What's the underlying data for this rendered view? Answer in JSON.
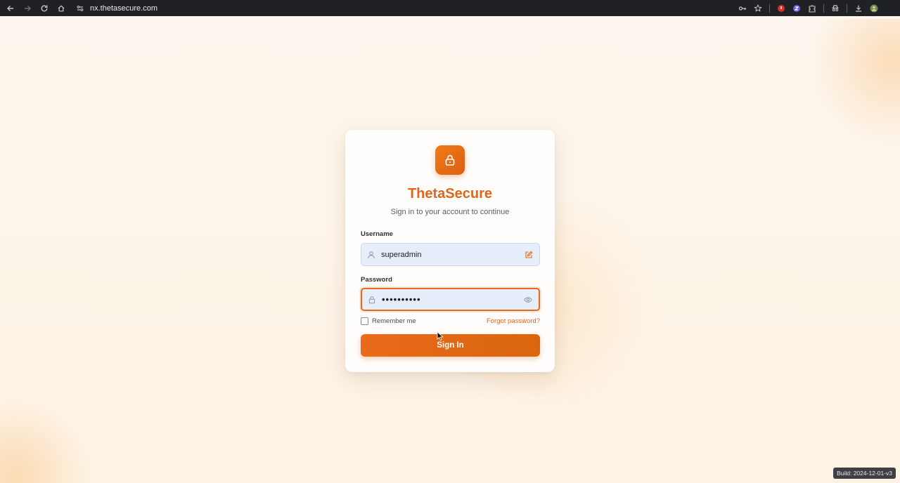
{
  "browser": {
    "url": "nx.thetasecure.com",
    "nav_icons": [
      "back-icon",
      "forward-icon",
      "reload-icon",
      "home-icon"
    ],
    "right_icons": [
      "key-icon",
      "star-icon",
      "extension-red-icon",
      "extension-purple-icon",
      "puzzle-icon",
      "incognito-icon",
      "download-icon",
      "profile-avatar"
    ]
  },
  "login": {
    "brand": "ThetaSecure",
    "subtitle": "Sign in to your account to continue",
    "username_label": "Username",
    "username_value": "superadmin",
    "password_label": "Password",
    "password_value": "••••••••••",
    "remember_label": "Remember me",
    "remember_checked": false,
    "forgot_label": "Forgot password?",
    "signin_label": "Sign In"
  },
  "build_label": "Build: 2024-12-01-v3",
  "colors": {
    "accent": "#e0661a",
    "button": "#ea6a1c",
    "field_bg": "#e6eefb",
    "chrome": "#202124"
  }
}
